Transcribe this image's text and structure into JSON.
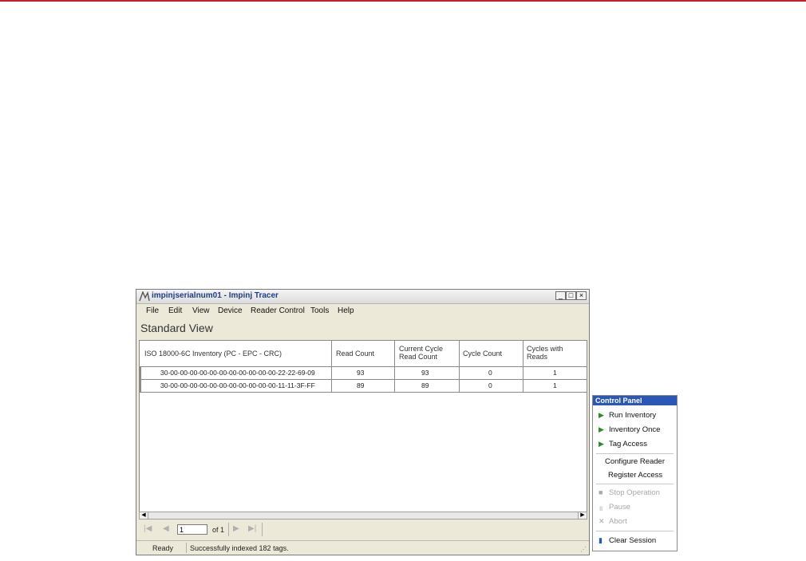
{
  "window": {
    "title": "impinjserialnum01 - Impinj Tracer",
    "buttons": {
      "minimize": "_",
      "maximize": "□",
      "close": "×"
    }
  },
  "menu": [
    "File",
    "Edit",
    "View",
    "Device",
    "Reader Control",
    "Tools",
    "Help"
  ],
  "view_title": "Standard View",
  "table": {
    "headers": [
      "ISO 18000-6C Inventory (PC - EPC - CRC)",
      "Read Count",
      "Current Cycle Read Count",
      "Cycle Count",
      "Cycles with Reads"
    ],
    "rows": [
      [
        "30-00-00-00-00-00-00-00-00-00-00-00-22-22-69-09",
        "93",
        "93",
        "0",
        "1"
      ],
      [
        "30-00-00-00-00-00-00-00-00-00-00-00-11-11-3F-FF",
        "89",
        "89",
        "0",
        "1"
      ]
    ]
  },
  "pager": {
    "page": "1",
    "of_text": "of 1"
  },
  "status": {
    "ready": "Ready",
    "message": "Successfully indexed 182 tags."
  },
  "control_panel": {
    "title": "Control Panel",
    "run_inventory": "Run Inventory",
    "inventory_once": "Inventory Once",
    "tag_access": "Tag Access",
    "configure_reader": "Configure Reader",
    "register_access": "Register Access",
    "stop_operation": "Stop Operation",
    "pause": "Pause",
    "abort": "Abort",
    "clear_session": "Clear Session"
  },
  "colors": {
    "accent_red": "#c8202a",
    "panel_header": "#2b57b5",
    "play_green": "#2e8b2e"
  }
}
